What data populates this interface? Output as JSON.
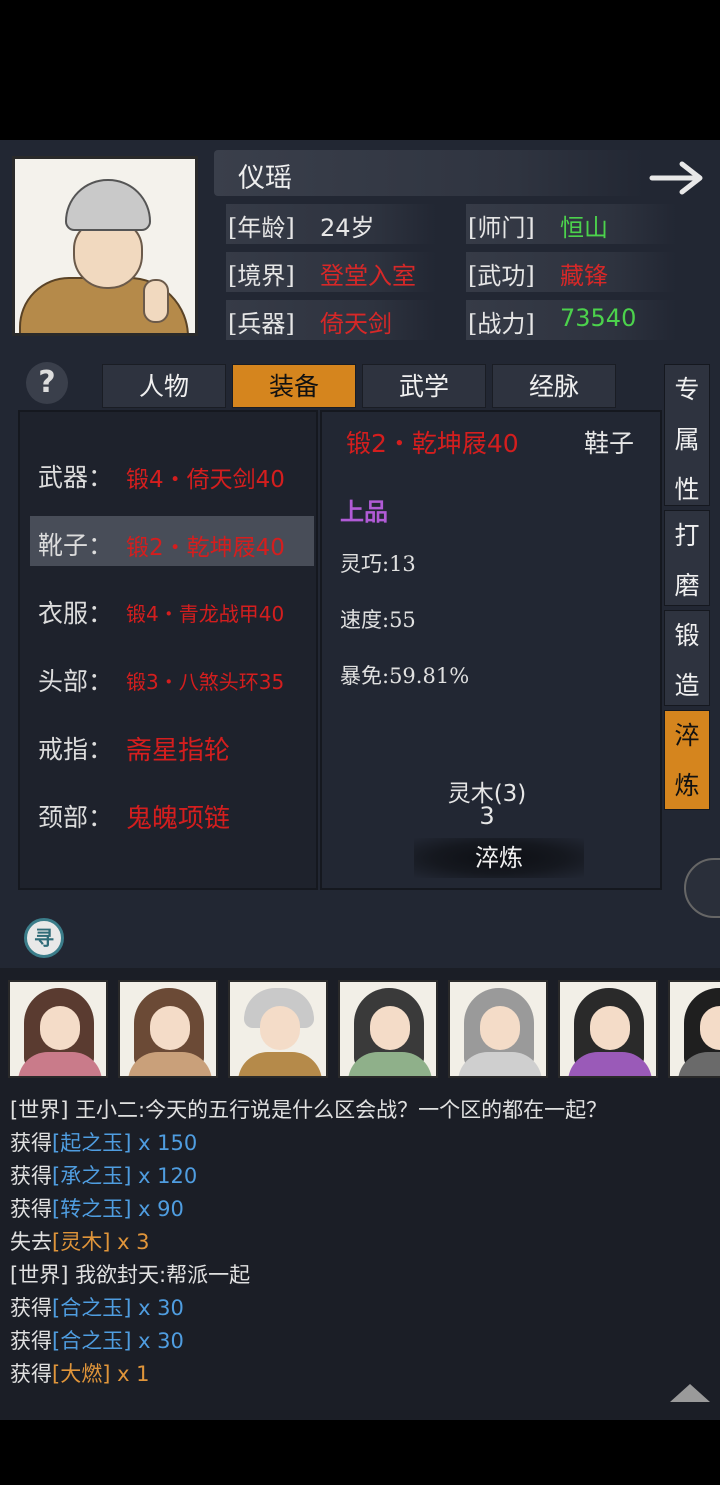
{
  "character": {
    "name": "仪瑶",
    "labels": {
      "age": "[年龄]",
      "school": "[师门]",
      "realm": "[境界]",
      "martial": "[武功]",
      "weapon": "[兵器]",
      "power": "[战力]"
    },
    "age": "24岁",
    "school": "恒山",
    "realm": "登堂入室",
    "martial": "藏锋",
    "weapon": "倚天剑",
    "power": "73540"
  },
  "help_label": "?",
  "tabs": [
    "人物",
    "装备",
    "武学",
    "经脉"
  ],
  "active_tab": "装备",
  "equipment": [
    {
      "slot": "武器：",
      "item": "锻4・倚天剑40"
    },
    {
      "slot": "靴子：",
      "item": "锻2・乾坤屐40"
    },
    {
      "slot": "衣服：",
      "item": "锻4・青龙战甲40"
    },
    {
      "slot": "头部：",
      "item": "锻3・八煞头环35"
    },
    {
      "slot": "戒指：",
      "item": "斋星指轮"
    },
    {
      "slot": "颈部：",
      "item": "鬼魄项链"
    }
  ],
  "detail": {
    "title": "锻2・乾坤屐40",
    "type": "鞋子",
    "grade": "上品",
    "stats": [
      "灵巧:13",
      "速度:55",
      "暴免:59.81%"
    ],
    "material": "灵木(3)",
    "material_count": "3",
    "action_label": "淬炼"
  },
  "side_tabs": [
    {
      "label": "专属性",
      "chars": [
        "专",
        "属",
        "性"
      ]
    },
    {
      "label": "打磨",
      "chars": [
        "打",
        "磨"
      ]
    },
    {
      "label": "锻造",
      "chars": [
        "锻",
        "造"
      ]
    },
    {
      "label": "淬炼",
      "chars": [
        "淬",
        "炼"
      ]
    }
  ],
  "search_label": "寻",
  "chat": [
    {
      "prefix": "[世界] ",
      "text": "王小二:今天的五行说是什么区会战？一个区的都在一起？"
    },
    {
      "prefix": "获得",
      "item": "[起之玉]",
      "qty": " x 150",
      "color": "blue"
    },
    {
      "prefix": "获得",
      "item": "[承之玉]",
      "qty": " x 120",
      "color": "blue"
    },
    {
      "prefix": "获得",
      "item": "[转之玉]",
      "qty": " x 90",
      "color": "blue"
    },
    {
      "prefix": "失去",
      "item": "[灵木]",
      "qty": " x 3",
      "color": "orange"
    },
    {
      "prefix": "[世界] ",
      "text": "我欲封天:帮派一起"
    },
    {
      "prefix": "获得",
      "item": "[合之玉]",
      "qty": " x 30",
      "color": "blue"
    },
    {
      "prefix": "获得",
      "item": "[合之玉]",
      "qty": " x 30",
      "color": "blue"
    },
    {
      "prefix": "获得",
      "item": "[大燃]",
      "qty": " x 1",
      "color": "orange"
    }
  ],
  "colors": {
    "accent": "#d5851e",
    "item_red": "#d41e1e",
    "good_green": "#4cd24c",
    "grade_purple": "#b15bd6",
    "chat_blue": "#4f9de0",
    "chat_orange": "#e0953a"
  }
}
